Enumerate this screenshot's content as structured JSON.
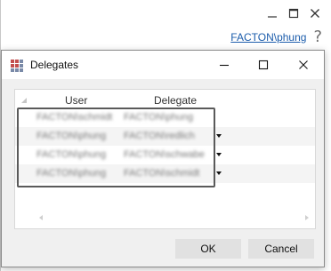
{
  "app": {
    "user_link": "FACTON\\phung",
    "help_glyph": "?",
    "controls": {
      "minimize_glyph": "—",
      "maximize_glyph": "☐",
      "close_glyph": "✕"
    }
  },
  "dialog": {
    "title": "Delegates",
    "icon": "grid-app-icon",
    "controls": {
      "minimize_glyph": "—",
      "maximize_glyph": "☐",
      "close_glyph": "✕"
    },
    "grid": {
      "columns": [
        "User",
        "Delegate"
      ],
      "rows": [
        {
          "user": "FACTON\\schmidt",
          "delegate": "FACTON\\phung",
          "has_dropdown": false
        },
        {
          "user": "FACTON\\phung",
          "delegate": "FACTON\\redlich",
          "has_dropdown": true
        },
        {
          "user": "FACTON\\phung",
          "delegate": "FACTON\\schwabe",
          "has_dropdown": true
        },
        {
          "user": "FACTON\\phung",
          "delegate": "FACTON\\schmidt",
          "has_dropdown": true
        }
      ]
    },
    "buttons": {
      "ok": "OK",
      "cancel": "Cancel"
    }
  },
  "colors": {
    "link": "#1b5cab",
    "dialog_bg": "#f0f0f0",
    "button_bg": "#e1e1e1",
    "selection_border": "#5a5a5a"
  }
}
